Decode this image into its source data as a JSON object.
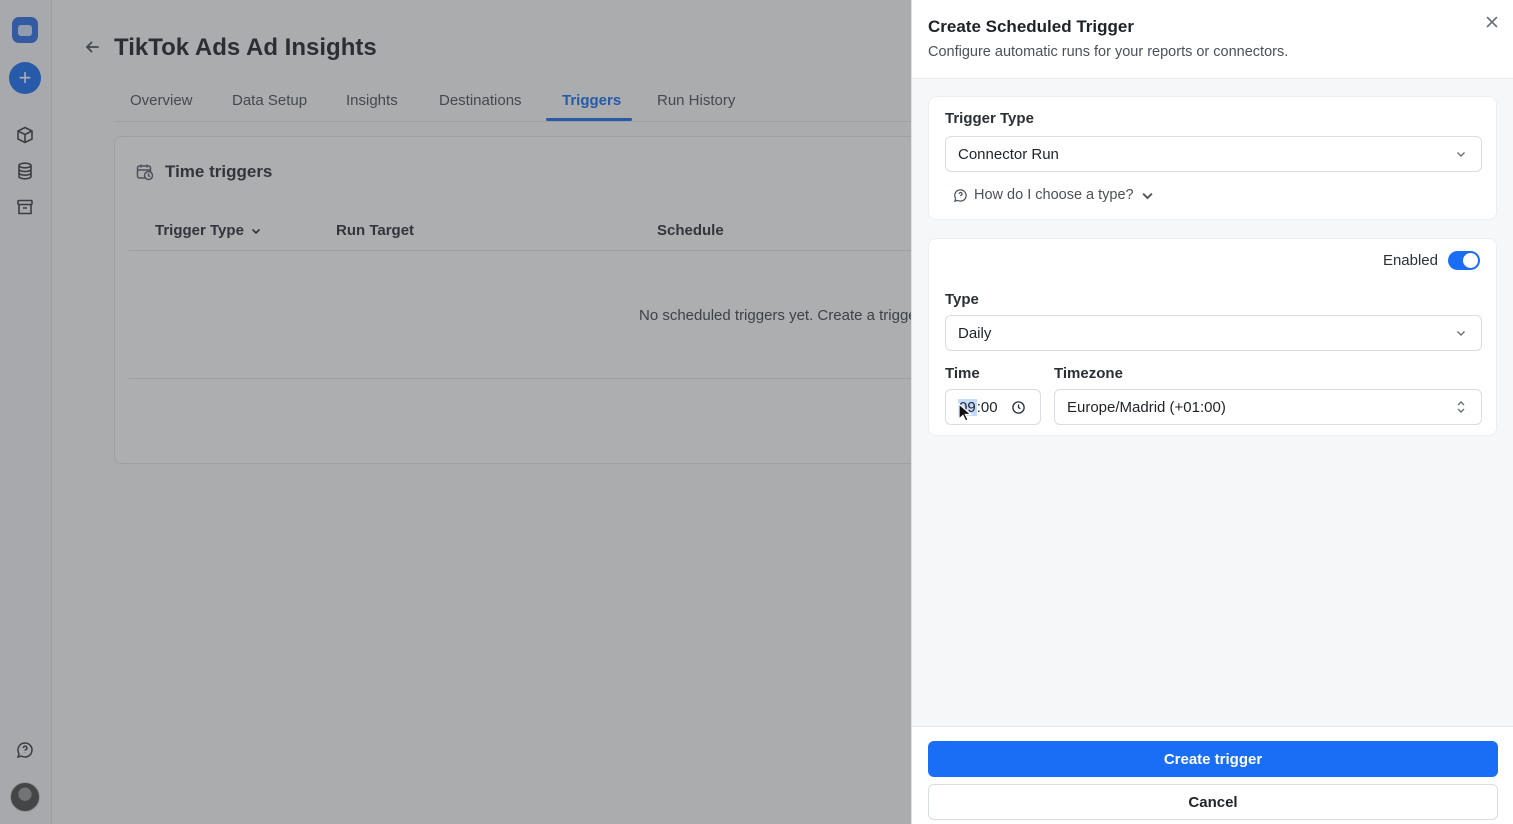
{
  "main": {
    "page_title": "TikTok Ads Ad Insights",
    "tabs": [
      {
        "label": "Overview"
      },
      {
        "label": "Data Setup"
      },
      {
        "label": "Insights"
      },
      {
        "label": "Destinations"
      },
      {
        "label": "Triggers",
        "active": true
      },
      {
        "label": "Run History"
      }
    ],
    "section_title": "Time triggers",
    "table": {
      "columns": [
        "Trigger Type",
        "Run Target",
        "Schedule"
      ],
      "empty_message": "No scheduled triggers yet. Create a trigger t"
    }
  },
  "panel": {
    "title": "Create Scheduled Trigger",
    "subtitle": "Configure automatic runs for your reports or connectors.",
    "trigger_type": {
      "label": "Trigger Type",
      "value": "Connector Run",
      "help": "How do I choose a type?"
    },
    "schedule": {
      "enabled_label": "Enabled",
      "enabled": true,
      "type_label": "Type",
      "type_value": "Daily",
      "time_label": "Time",
      "time_hour": "09",
      "time_rest": ":00",
      "timezone_label": "Timezone",
      "timezone_value": "Europe/Madrid (+01:00)"
    },
    "create_button": "Create trigger",
    "cancel_button": "Cancel"
  },
  "colors": {
    "accent": "#1a6ef5",
    "overlay": "#3c3e42"
  },
  "icons": [
    "app-logo-icon",
    "plus-icon",
    "cube-icon",
    "database-icon",
    "archive-icon",
    "chat-icon",
    "back-arrow-icon",
    "calendar-clock-icon",
    "chevron-down-icon",
    "close-icon",
    "help-chat-icon",
    "clock-icon",
    "up-down-chevron-icon"
  ]
}
